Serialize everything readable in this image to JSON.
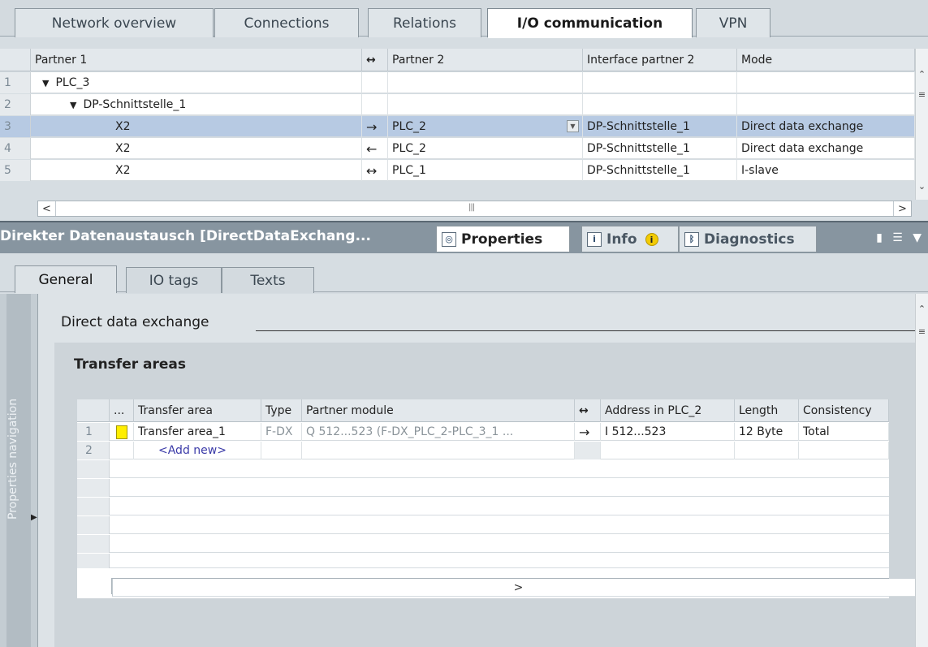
{
  "editor_tabs": [
    "Network overview",
    "Connections",
    "Relations",
    "I/O communication",
    "VPN"
  ],
  "active_editor_tab": "I/O communication",
  "top_table": {
    "columns": [
      "Partner 1",
      "↔",
      "Partner 2",
      "Interface partner 2",
      "Mode"
    ],
    "rows": [
      {
        "num": "1",
        "partner1": "PLC_3",
        "tri": "▼",
        "dir": "",
        "partner2": "",
        "iface": "",
        "mode": ""
      },
      {
        "num": "2",
        "partner1": "DP-Schnittstelle_1",
        "tri": "▼",
        "dir": "",
        "partner2": "",
        "iface": "",
        "mode": ""
      },
      {
        "num": "3",
        "partner1": "X2",
        "tri": "",
        "dir": "→",
        "partner2": "PLC_2",
        "iface": "DP-Schnittstelle_1",
        "mode": "Direct data exchange"
      },
      {
        "num": "4",
        "partner1": "X2",
        "tri": "",
        "dir": "←",
        "partner2": "PLC_2",
        "iface": "DP-Schnittstelle_1",
        "mode": "Direct data exchange"
      },
      {
        "num": "5",
        "partner1": "X2",
        "tri": "",
        "dir": "↔",
        "partner2": "PLC_1",
        "iface": "DP-Schnittstelle_1",
        "mode": "I-slave"
      }
    ]
  },
  "inspector": {
    "title": "Direkter Datenaustausch [DirectDataExchang...",
    "tabs": [
      "Properties",
      "Info",
      "Diagnostics"
    ],
    "active_tab": "Properties",
    "sub_tabs": [
      "General",
      "IO tags",
      "Texts"
    ],
    "active_sub_tab": "General",
    "nav_label": "Properties navigation",
    "section_title": "Direct data exchange",
    "panel_title": "Transfer areas"
  },
  "transfer_table": {
    "columns": [
      "...",
      "Transfer area",
      "Type",
      "Partner module",
      "↔",
      "Address in PLC_2",
      "Length",
      "Consistency"
    ],
    "rows": [
      {
        "num": "1",
        "area": "Transfer area_1",
        "type": "F-DX",
        "partner": "Q 512...523 (F-DX_PLC_2-PLC_3_1 ...",
        "dir": "→",
        "address": "I 512...523",
        "length": "12 Byte",
        "consistency": "Total"
      },
      {
        "num": "2",
        "area": "<Add new>",
        "type": "",
        "partner": "",
        "dir": "",
        "address": "",
        "length": "",
        "consistency": ""
      }
    ]
  },
  "icons": {
    "properties": "properties-icon",
    "info": "info-icon",
    "diagnostics": "diagnostics-icon"
  },
  "colors": {
    "selection": "#b7cae3",
    "transfer_marker": "#ffee00"
  }
}
